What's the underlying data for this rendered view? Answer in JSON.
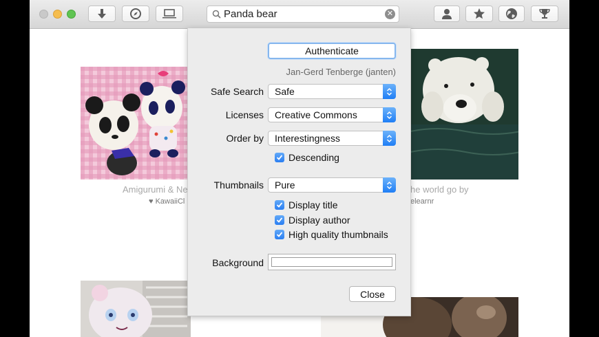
{
  "search": {
    "value": "Panda bear"
  },
  "photos": [
    {
      "caption": "Amigurumi & Ne",
      "author": "♥ KawaiiCl"
    },
    {
      "caption": "he world go by",
      "author": "elearnr"
    }
  ],
  "prefs": {
    "authenticate_label": "Authenticate",
    "user": "Jan-Gerd Tenberge (janten)",
    "safe_search": {
      "label": "Safe Search",
      "value": "Safe"
    },
    "licenses": {
      "label": "Licenses",
      "value": "Creative Commons"
    },
    "order_by": {
      "label": "Order by",
      "value": "Interestingness"
    },
    "descending": {
      "label": "Descending",
      "checked": true
    },
    "thumbnails": {
      "label": "Thumbnails",
      "value": "Pure"
    },
    "display_title": {
      "label": "Display title",
      "checked": true
    },
    "display_author": {
      "label": "Display author",
      "checked": true
    },
    "high_quality": {
      "label": "High quality thumbnails",
      "checked": true
    },
    "background_label": "Background",
    "background_color": "#ffffff",
    "close_label": "Close"
  },
  "colors": {
    "accent": "#2a7ef2",
    "checkbox": "#3a8cf5"
  }
}
